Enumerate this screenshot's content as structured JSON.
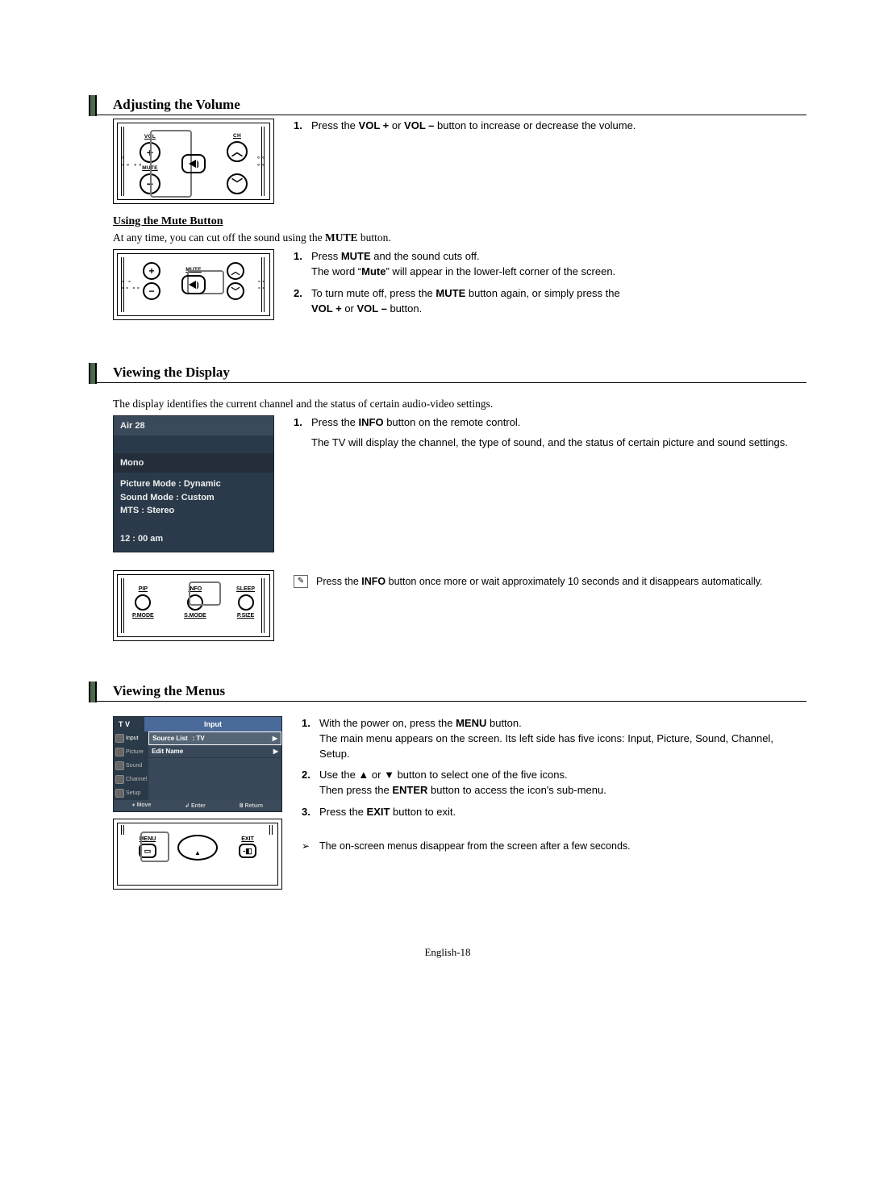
{
  "section1": {
    "heading": "Adjusting the Volume",
    "step1_pre": "Press the ",
    "step1_b1": "VOL +",
    "step1_mid": " or ",
    "step1_b2": "VOL –",
    "step1_post": " button to increase or decrease the volume.",
    "remote": {
      "vol": "VOL",
      "ch": "CH",
      "mute": "MUTE",
      "plus": "+",
      "minus": "−",
      "up": "︿",
      "down": "﹀"
    }
  },
  "mute": {
    "subheading": "Using the Mute Button",
    "bodyline_pre": "At any time, you can cut off the sound using the ",
    "bodyline_b": "MUTE",
    "bodyline_post": " button.",
    "s1_pre": "Press ",
    "s1_b": "MUTE",
    "s1_post": " and the sound cuts off.",
    "s1_l2_pre": "The word “",
    "s1_l2_b": "Mute",
    "s1_l2_post": "” will appear in the lower-left corner of the screen.",
    "s2_pre": "To turn mute off, press the ",
    "s2_b1": "MUTE",
    "s2_mid1": " button again, or simply press the ",
    "s2_b2": "VOL +",
    "s2_mid2": " or ",
    "s2_b3": "VOL –",
    "s2_post": " button."
  },
  "section2": {
    "heading": "Viewing the Display",
    "intro": "The display identifies the current channel and the status of certain audio-video settings.",
    "s1_pre": "Press the ",
    "s1_b": "INFO",
    "s1_post": " button on the remote control.",
    "s1_l2": "The TV will display the channel, the type of sound, and the status of certain picture and sound settings.",
    "note_pre": "Press the ",
    "note_b": "INFO",
    "note_post": " button once more or wait approximately 10 seconds and it disappears automatically.",
    "osd": {
      "channel": "Air 28",
      "audio": "Mono",
      "picmode": "Picture Mode : Dynamic",
      "sndmode": "Sound Mode : Custom",
      "mts": "MTS : Stereo",
      "time": "12 : 00 am"
    },
    "remote2": {
      "pip": "PIP",
      "info": "INFO",
      "sleep": "SLEEP",
      "pmode": "P.MODE",
      "smode": "S.MODE",
      "psize": "P.SIZE"
    }
  },
  "section3": {
    "heading": "Viewing the Menus",
    "s1_pre": "With the power on, press the ",
    "s1_b": "MENU",
    "s1_post": " button.",
    "s1_l2": "The main menu appears on the screen. Its left side has five icons: Input, Picture, Sound, Channel, Setup.",
    "s2_pre": "Use the ",
    "s2_up": "▲",
    "s2_mid": " or ",
    "s2_dn": "▼",
    "s2_post": " button to select one of the five icons.",
    "s2_l2_pre": "Then press the ",
    "s2_l2_b": "ENTER",
    "s2_l2_post": " button to access the icon's sub-menu.",
    "s3_pre": "Press the ",
    "s3_b": "EXIT",
    "s3_post": " button to exit.",
    "tip": "The on-screen menus disappear from the screen after a few seconds.",
    "tvmenu": {
      "tv": "T V",
      "headerTitle": "Input",
      "side": [
        "Input",
        "Picture",
        "Sound",
        "Channel",
        "Setup"
      ],
      "row1a": "Source List",
      "row1b": ": TV",
      "row2": "Edit Name",
      "foot_move": "Move",
      "foot_enter": "Enter",
      "foot_return": "Return",
      "foot_move_sym": "♦",
      "foot_enter_sym": "↲",
      "foot_return_sym": "Ⅲ"
    },
    "remote3": {
      "menu": "MENU",
      "exit": "EXIT",
      "menu_sym": "▭",
      "exit_sym": "-◧"
    }
  },
  "pagenum": "English-18"
}
